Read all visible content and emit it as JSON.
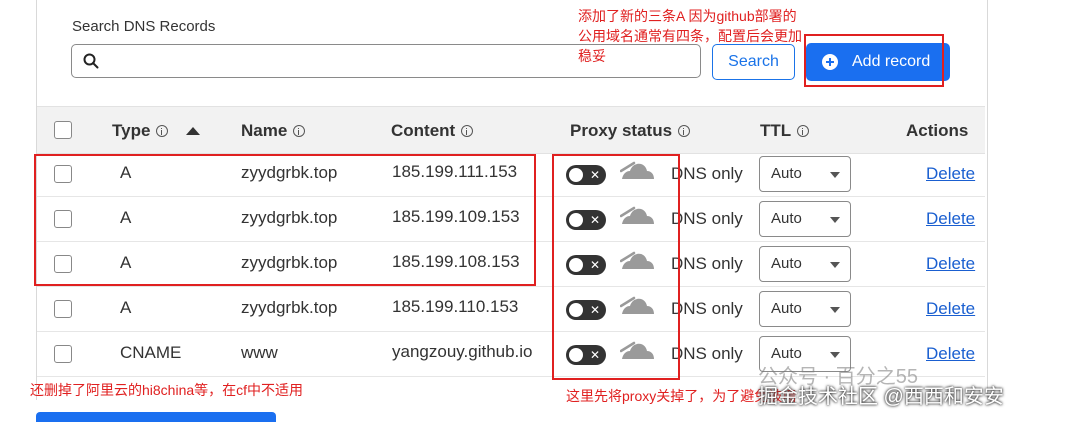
{
  "search": {
    "label": "Search DNS Records",
    "value": "",
    "placeholder": "",
    "search_button": "Search",
    "add_button": "Add record"
  },
  "columns": {
    "type": "Type",
    "name": "Name",
    "content": "Content",
    "proxy_status": "Proxy status",
    "ttl": "TTL",
    "actions": "Actions"
  },
  "records": [
    {
      "type": "A",
      "name": "zyydgrbk.top",
      "content": "185.199.111.153",
      "proxy": "DNS only",
      "ttl": "Auto",
      "action": "Delete"
    },
    {
      "type": "A",
      "name": "zyydgrbk.top",
      "content": "185.199.109.153",
      "proxy": "DNS only",
      "ttl": "Auto",
      "action": "Delete"
    },
    {
      "type": "A",
      "name": "zyydgrbk.top",
      "content": "185.199.108.153",
      "proxy": "DNS only",
      "ttl": "Auto",
      "action": "Delete"
    },
    {
      "type": "A",
      "name": "zyydgrbk.top",
      "content": "185.199.110.153",
      "proxy": "DNS only",
      "ttl": "Auto",
      "action": "Delete"
    },
    {
      "type": "CNAME",
      "name": "www",
      "content": "yangzouy.github.io",
      "proxy": "DNS only",
      "ttl": "Auto",
      "action": "Delete"
    }
  ],
  "annotations": {
    "top_right": [
      "添加了新的三条A 因为github部署的",
      "公用域名通常有四条，配置后会更加",
      "稳妥"
    ],
    "bottom_left": "还删掉了阿里云的hi8china等，在cf中不适用",
    "bottom_middle": "这里先将proxy关掉了，为了避免被墙"
  },
  "watermarks": {
    "wechat": "公众号 · 百分之55",
    "community": "掘金技术社区 @西西和安安"
  },
  "colors": {
    "accent": "#1a6ff0",
    "annotation": "#e02020",
    "link": "#1a5fd0"
  }
}
